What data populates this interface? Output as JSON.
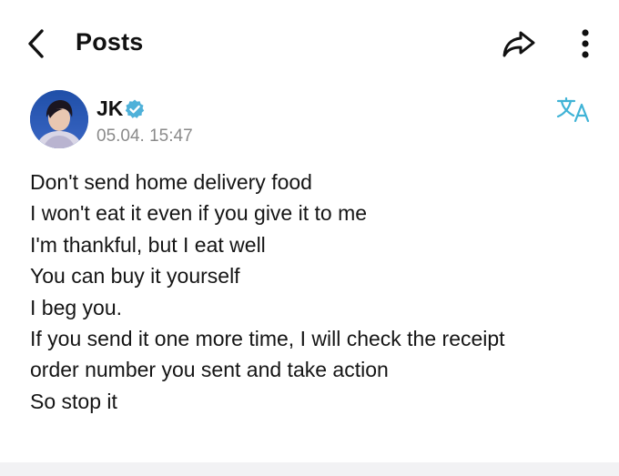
{
  "header": {
    "title": "Posts",
    "back_icon": "chevron-left-icon",
    "share_icon": "share-arrow-icon",
    "more_icon": "more-vertical-icon"
  },
  "post": {
    "author": "JK",
    "verified": true,
    "timestamp": "05.04. 15:47",
    "translate_icon": "translate-icon",
    "lines": [
      "Don't send home delivery food",
      "I won't eat it even if you give it to me",
      "I'm thankful, but I eat well",
      "You can buy it yourself",
      "I beg you.",
      "If you send it one more time, I will check the receipt",
      "order number you sent and take action",
      "So stop it"
    ]
  },
  "colors": {
    "verified_badge": "#4fb1d9",
    "translate_icon": "#3fb3d6",
    "timestamp": "#8a8a8a",
    "text": "#151515"
  }
}
